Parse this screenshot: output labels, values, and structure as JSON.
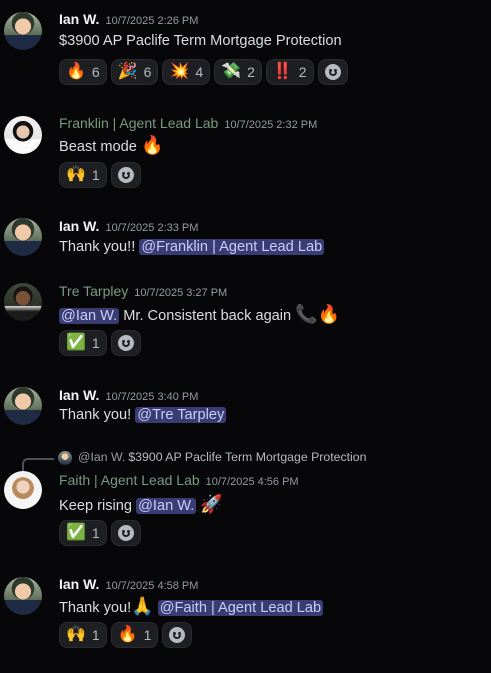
{
  "messages": [
    {
      "author": "Ian W.",
      "timestamp": "10/7/2025 2:26 PM",
      "text": "$3900 AP Paclife Term  Mortgage Protection",
      "reactions": [
        {
          "emoji": "🔥",
          "count": "6"
        },
        {
          "emoji": "🎉",
          "count": "6"
        },
        {
          "emoji": "💥",
          "count": "4"
        },
        {
          "emoji": "💸",
          "count": "2"
        },
        {
          "emoji": "‼️",
          "count": "2"
        }
      ]
    },
    {
      "author": "Franklin | Agent Lead Lab",
      "timestamp": "10/7/2025 2:32 PM",
      "text": "Beast mode",
      "text_emoji": "🔥",
      "reactions": [
        {
          "emoji": "🙌",
          "count": "1"
        }
      ]
    },
    {
      "author": "Ian W.",
      "timestamp": "10/7/2025 2:33 PM",
      "text": "Thank you!! ",
      "mention": "@Franklin | Agent Lead Lab"
    },
    {
      "author": "Tre Tarpley",
      "timestamp": "10/7/2025 3:27 PM",
      "mention": "@Ian W.",
      "text": " Mr. Consistent back again ",
      "text_emoji": "📞🔥",
      "reactions": [
        {
          "emoji": "✅",
          "count": "1"
        }
      ]
    },
    {
      "author": "Ian W.",
      "timestamp": "10/7/2025 3:40 PM",
      "text": "Thank you! ",
      "mention": "@Tre Tarpley"
    },
    {
      "author": "Faith | Agent Lead Lab",
      "timestamp": "10/7/2025 4:56 PM",
      "reply": {
        "author": "@Ian W.",
        "text": "$3900 AP Paclife Term  Mortgage Protection"
      },
      "text": "Keep rising ",
      "mention": "@Ian W.",
      "text_emoji": "🚀",
      "reactions": [
        {
          "emoji": "✅",
          "count": "1"
        }
      ]
    },
    {
      "author": "Ian W.",
      "timestamp": "10/7/2025 4:58 PM",
      "text": "Thank you!",
      "text_emoji": "🙏",
      "mention": "@Faith | Agent Lead Lab",
      "reactions": [
        {
          "emoji": "🙌",
          "count": "1"
        },
        {
          "emoji": "🔥",
          "count": "1"
        }
      ]
    }
  ],
  "colors": {
    "background": "#070709",
    "mention_bg": "#3a3d73",
    "mention_text": "#c9cdfb",
    "role_name_green": "#7a9a7e"
  },
  "icons": {
    "add_reaction": "smile-add-reaction-icon"
  }
}
